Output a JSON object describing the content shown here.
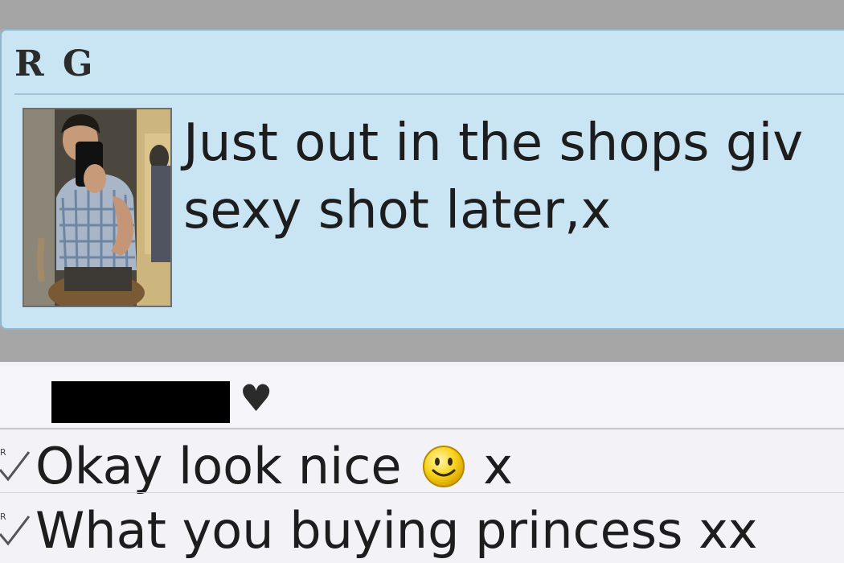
{
  "incoming_message": {
    "sender": "R G",
    "text_line1": "Just out in the shops giv",
    "text_line2": "sexy shot later,x",
    "photo_icon": "profile-photo"
  },
  "conversation": {
    "contact_status_icon": "heart-icon",
    "heart_glyph": "♥",
    "replies": [
      {
        "text_before": "Okay look nice",
        "emoticon": "smiley-icon",
        "text_after": "x",
        "status_icon": "read-check-icon"
      },
      {
        "text": "What you buying princess xx",
        "status_icon": "read-check-icon"
      }
    ]
  },
  "colors": {
    "bubble_bg": "#c9e4f3",
    "bubble_border": "#8fb7cf",
    "chat_bg": "#f2f2f7",
    "separator_gray": "#a6a6a6",
    "smiley_yellow": "#f7d21c"
  }
}
